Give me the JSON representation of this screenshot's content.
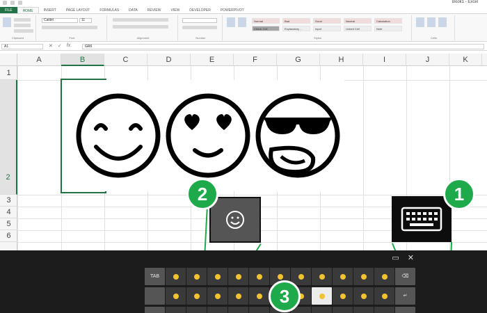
{
  "window": {
    "title": "Book1 - Excel"
  },
  "tabs": [
    "FILE",
    "HOME",
    "INSERT",
    "PAGE LAYOUT",
    "FORMULAS",
    "DATA",
    "REVIEW",
    "VIEW",
    "DEVELOPER",
    "POWERPIVOT"
  ],
  "active_tab_index": 1,
  "ribbon": {
    "font_name": "Calibri",
    "font_size": "11",
    "groups": [
      "Clipboard",
      "Font",
      "Alignment",
      "Number",
      "Styles",
      "Cells"
    ],
    "style_cells": [
      "Normal",
      "Bad",
      "Good",
      "Neutral",
      "Calculation",
      "Check Cell",
      "Explanatory ...",
      "Input",
      "Linked Cell",
      "Note"
    ]
  },
  "formula_bar": {
    "name_box": "A1",
    "cancel_icon": "✕",
    "enter_icon": "✓",
    "fx_label": "fx",
    "content": "GR6"
  },
  "columns": [
    "A",
    "B",
    "C",
    "D",
    "E",
    "F",
    "G",
    "H",
    "I",
    "J",
    "K"
  ],
  "selected_column": "B",
  "rows": [
    "1",
    "2",
    "3",
    "4",
    "5",
    "6"
  ],
  "selected_row": "2",
  "emoji_image": {
    "faces": [
      "smiling-face",
      "heart-eyes-face",
      "sunglasses-face"
    ]
  },
  "callouts": [
    "1",
    "2",
    "3"
  ],
  "touch_keyboard": {
    "tab_label": "TAB",
    "backspace_icon": "⌫",
    "enter_icon": "↵",
    "close_icon": "✕",
    "dock_icon": "▭"
  },
  "colors": {
    "excel_green": "#217346",
    "callout_green": "#1ea94a",
    "keyboard_bg": "#1c1c1c",
    "emoji_yellow": "#f2c230"
  }
}
